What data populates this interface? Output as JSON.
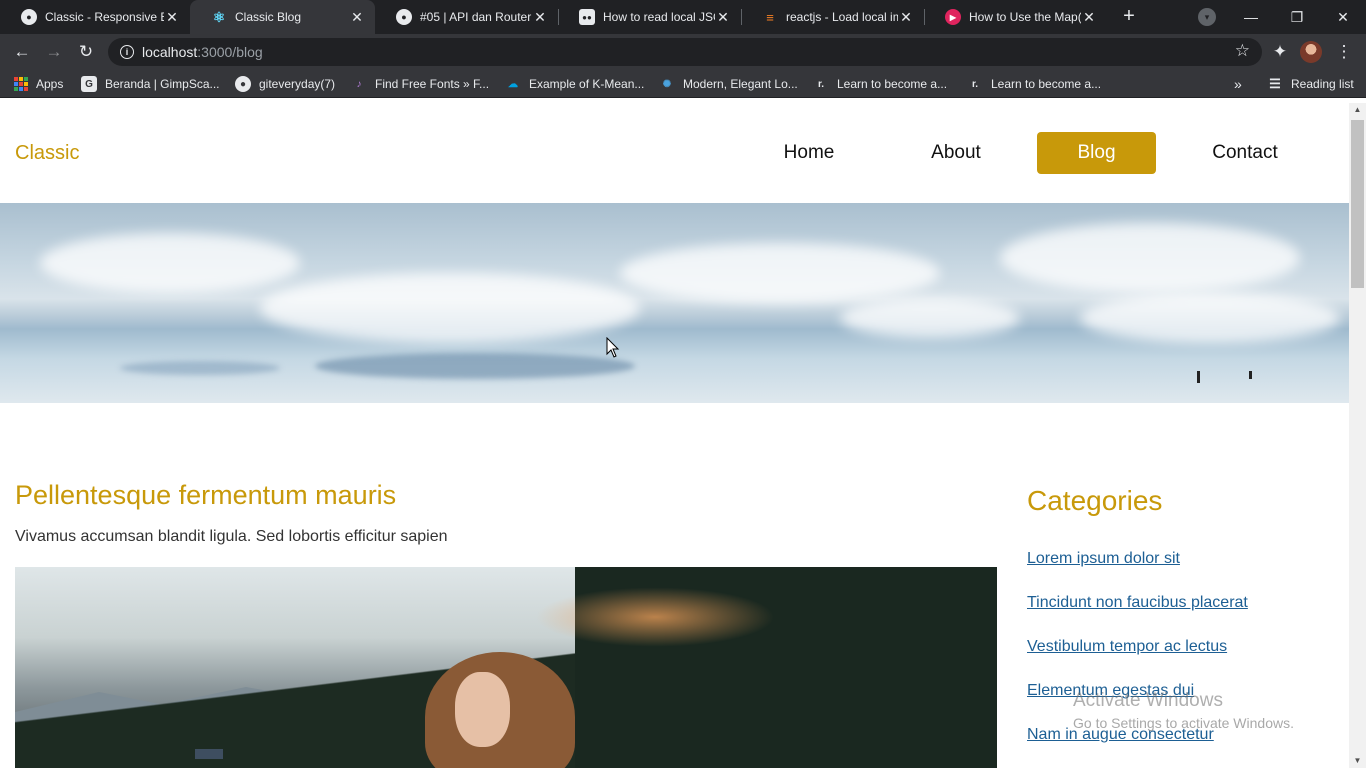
{
  "browser": {
    "tabs": [
      {
        "title": "Classic - Responsive B",
        "active": false
      },
      {
        "title": "Classic Blog",
        "active": true
      },
      {
        "title": "#05 | API dan Router d",
        "active": false
      },
      {
        "title": "How to read local JSO",
        "active": false
      },
      {
        "title": "reactjs - Load local im",
        "active": false
      },
      {
        "title": "How to Use the Map()",
        "active": false
      }
    ],
    "url_host": "localhost",
    "url_path": ":3000/blog",
    "bookmarks": [
      {
        "label": "Apps"
      },
      {
        "label": "Beranda | GimpSca..."
      },
      {
        "label": "giteveryday(7)"
      },
      {
        "label": "Find Free Fonts » F..."
      },
      {
        "label": "Example of K-Mean..."
      },
      {
        "label": "Modern, Elegant Lo..."
      },
      {
        "label": "Learn to become a..."
      },
      {
        "label": "Learn to become a..."
      }
    ],
    "reading_list": "Reading list",
    "icons": {
      "back": "back-arrow-icon",
      "forward": "forward-arrow-icon",
      "reload": "reload-icon",
      "star": "bookmark-star-icon",
      "extensions": "puzzle-icon",
      "menu": "kebab-menu-icon"
    }
  },
  "site": {
    "logo": "Classic",
    "nav": [
      {
        "label": "Home",
        "active": false
      },
      {
        "label": "About",
        "active": false
      },
      {
        "label": "Blog",
        "active": true
      },
      {
        "label": "Contact",
        "active": false
      }
    ],
    "post": {
      "title": "Pellentesque fermentum mauris",
      "subtitle": "Vivamus accumsan blandit ligula. Sed lobortis efficitur sapien"
    },
    "sidebar": {
      "title": "Categories",
      "links": [
        "Lorem ipsum dolor sit",
        "Tincidunt non faucibus placerat",
        "Vestibulum tempor ac lectus",
        "Elementum egestas dui",
        "Nam in augue consectetur"
      ]
    },
    "colors": {
      "accent": "#c8990a",
      "link": "#1d5f94"
    }
  },
  "os": {
    "watermark_title": "Activate Windows",
    "watermark_sub": "Go to Settings to activate Windows."
  }
}
